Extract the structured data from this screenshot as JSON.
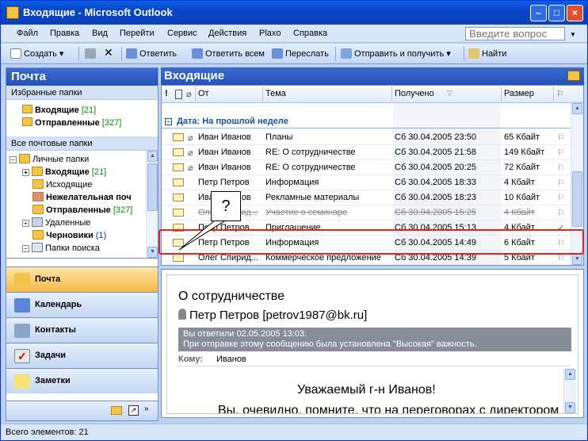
{
  "window": {
    "title": "Входящие - Microsoft Outlook"
  },
  "menu": [
    "Файл",
    "Правка",
    "Вид",
    "Перейти",
    "Сервис",
    "Действия",
    "Plaxo",
    "Справка"
  ],
  "ask": {
    "placeholder": "Введите вопрос"
  },
  "toolbar": {
    "create": "Создать",
    "reply": "Ответить",
    "reply_all": "Ответить всем",
    "forward": "Переслать",
    "send_receive": "Отправить и получить",
    "find": "Найти"
  },
  "nav": {
    "title": "Почта",
    "favorites_header": "Избранные папки",
    "favorites": [
      {
        "label": "Входящие",
        "count": "[21]"
      },
      {
        "label": "Отправленные",
        "count": "[327]"
      }
    ],
    "all_header": "Все почтовые папки",
    "tree": [
      {
        "label": "Личные папки",
        "count": ""
      },
      {
        "label": "Входящие",
        "count": "[21]"
      },
      {
        "label": "Исходящие",
        "count": ""
      },
      {
        "label": "Нежелательная поч",
        "count": ""
      },
      {
        "label": "Отправленные",
        "count": "[327]"
      },
      {
        "label": "Удаленные",
        "count": ""
      },
      {
        "label": "Черновики",
        "count": "(1)"
      },
      {
        "label": "Папки поиска",
        "count": ""
      }
    ],
    "buttons": [
      "Почта",
      "Календарь",
      "Контакты",
      "Задачи",
      "Заметки"
    ]
  },
  "main": {
    "title": "Входящие",
    "columns": {
      "importance": "!",
      "icon": "",
      "attach": "",
      "from": "От",
      "subject": "Тема",
      "received": "Получено",
      "size": "Размер"
    },
    "group": "Дата: На прошлой неделе",
    "rows": [
      {
        "from": "Иван Иванов",
        "subject": "Планы",
        "received": "Сб 30.04.2005 23:50",
        "size": "65 Кбайт",
        "attach": true
      },
      {
        "from": "Иван Иванов",
        "subject": "RE: О сотрудничестве",
        "received": "Сб 30.04.2005 21:58",
        "size": "149 Кбайт",
        "attach": true
      },
      {
        "from": "Иван Иванов",
        "subject": "RE: О сотрудничестве",
        "received": "Сб 30.04.2005 20:25",
        "size": "72 Кбайт",
        "attach": true
      },
      {
        "from": "Петр Петров",
        "subject": "Информация",
        "received": "Сб 30.04.2005 18:33",
        "size": "4 Кбайт",
        "attach": false
      },
      {
        "from": "Иван Иванов",
        "subject": "Рекламные материалы",
        "received": "Сб 30.04.2005 18:23",
        "size": "10 Кбайт",
        "attach": false
      },
      {
        "from": "Олег Спирид...",
        "subject": "Участие в семинаре",
        "received": "Сб 30.04.2005 15:25",
        "size": "4 Кбайт",
        "attach": false
      },
      {
        "from": "Петр Петров",
        "subject": "Приглашение",
        "received": "Сб 30.04.2005 15:13",
        "size": "4 Кбайт",
        "attach": false
      },
      {
        "from": "Петр Петров",
        "subject": "Информация",
        "received": "Сб 30.04.2005 14:49",
        "size": "6 Кбайт",
        "attach": false
      },
      {
        "from": "Олег Спирид...",
        "subject": "Коммерческое предложение",
        "received": "Сб 30.04.2005 14:39",
        "size": "5 Кбайт",
        "attach": false
      }
    ],
    "callout": "?"
  },
  "reading": {
    "subject": "О сотрудничестве",
    "from": "Петр Петров [petrov1987@bk.ru]",
    "info1": "Вы ответили 02.05.2005 13:03.",
    "info2": "При отправке этому сообщению была установлена \"Высокая\" важность.",
    "to_label": "Кому:",
    "to_value": "Иванов",
    "body1": "Уважаемый г-н Иванов!",
    "body2": "Вы, очевидно, помните, что на переговорах с директором"
  },
  "status": "Всего элементов: 21",
  "colors": {
    "accent": "#2652b5",
    "selected_nav": "#f8b94c",
    "highlight": "#e8221a"
  }
}
